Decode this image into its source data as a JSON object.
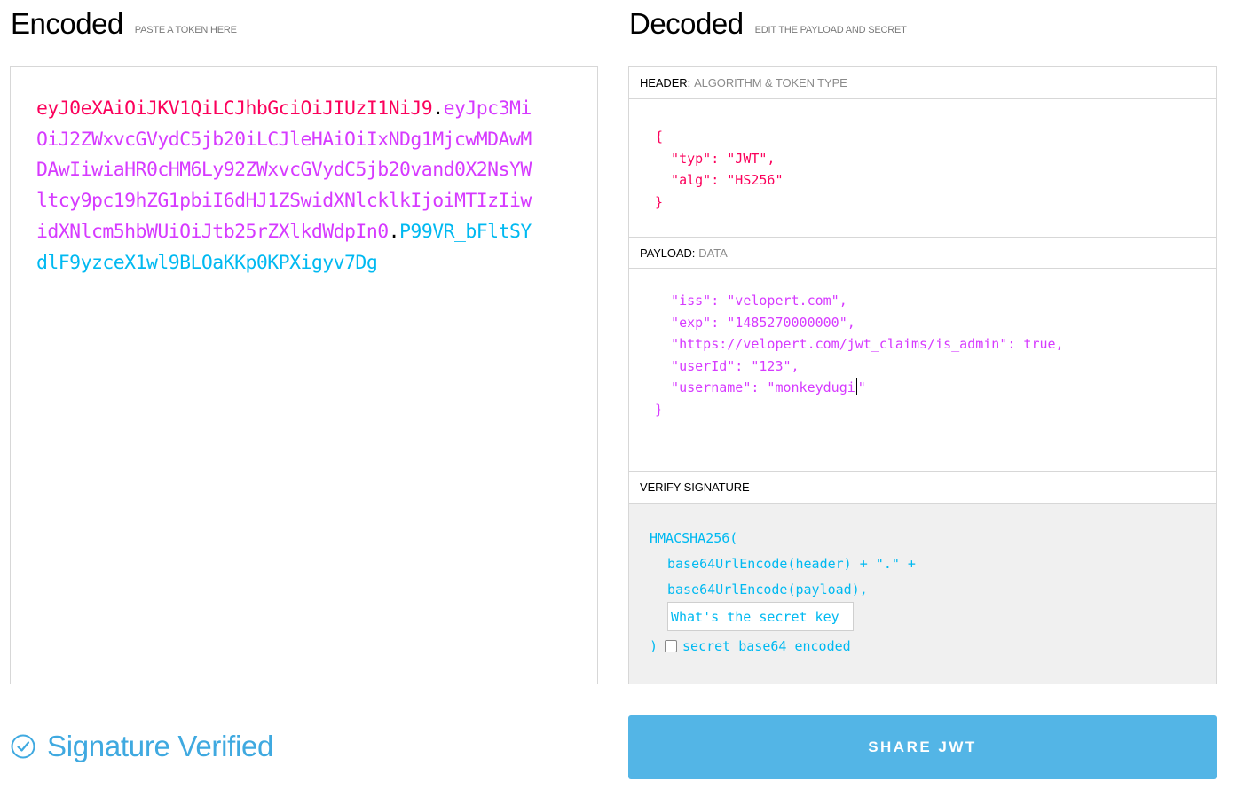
{
  "encoded": {
    "title": "Encoded",
    "subtitle": "PASTE A TOKEN HERE",
    "token": {
      "header": "eyJ0eXAiOiJKV1QiLCJhbGciOiJIUzI1NiJ9",
      "payload": "eyJpc3MiOiJ2ZWxvcGVydC5jb20iLCJleHAiOiIxNDg1MjcwMDAwMDAwIiwiaHR0cHM6Ly92ZWxvcGVydC5jb20vand0X2NsYWltcy9pc19hZG1pbiI6dHJ1ZSwidXNlcklkIjoiMTIzIiwidXNlcm5hbWUiOiJtb25rZXlkdWdpIn0",
      "signature": "P99VR_bFltSYdlF9yzceX1wl9BLOaKKp0KPXigyv7Dg",
      "dot": "."
    }
  },
  "decoded": {
    "title": "Decoded",
    "subtitle": "EDIT THE PAYLOAD AND SECRET",
    "header_section": {
      "label": "HEADER:",
      "sublabel": "ALGORITHM & TOKEN TYPE",
      "code": "{\n  \"typ\": \"JWT\",\n  \"alg\": \"HS256\"\n}"
    },
    "payload_section": {
      "label": "PAYLOAD:",
      "sublabel": "DATA",
      "code_before_caret": "  \"iss\": \"velopert.com\",\n  \"exp\": \"1485270000000\",\n  \"https://velopert.com/jwt_claims/is_admin\": true,\n  \"userId\": \"123\",\n  \"username\": \"monkeydugi",
      "code_after_caret": "\"\n}"
    },
    "verify_section": {
      "label": "VERIFY SIGNATURE",
      "line1": "HMACSHA256(",
      "line2": "base64UrlEncode(header) + \".\" +",
      "line3": "base64UrlEncode(payload),",
      "secret_placeholder": "What's the secret key",
      "secret_value": "",
      "close_paren": ")",
      "checkbox_label": "secret base64 encoded",
      "checkbox_checked": false
    }
  },
  "status": {
    "text": "Signature Verified",
    "icon": "check-circle-icon",
    "color": "#3fa9e0"
  },
  "share_button": {
    "label": "SHARE JWT",
    "color": "#53b5e6"
  },
  "colors": {
    "header": "#fb015b",
    "payload": "#d63aff",
    "signature": "#00b9f1"
  }
}
